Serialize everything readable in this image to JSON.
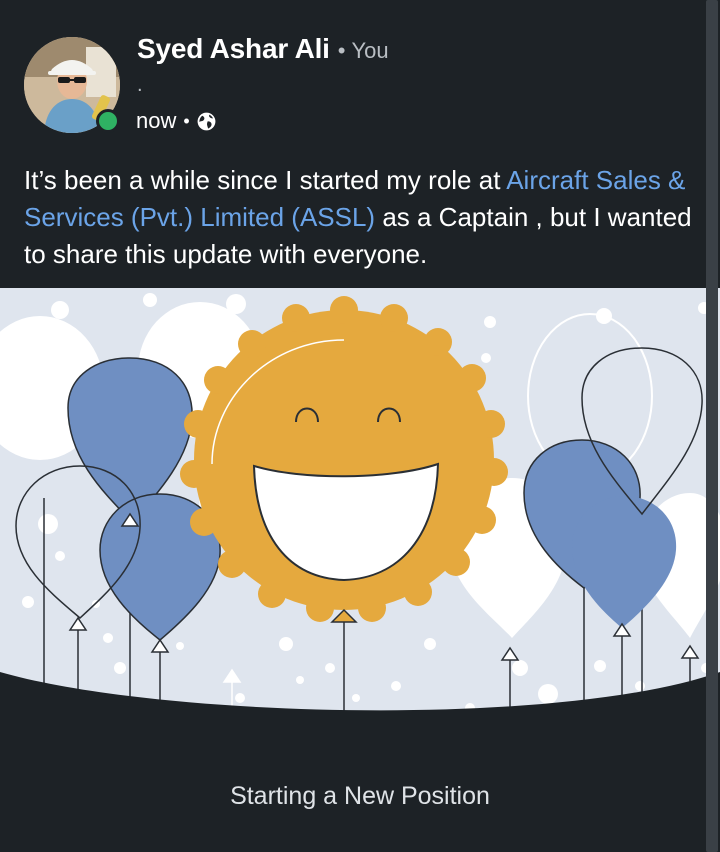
{
  "author": {
    "name": "Syed Ashar Ali",
    "relation": "You",
    "headline": ".",
    "timestamp": "now",
    "visibility_icon": "globe-icon",
    "presence_color": "#2fb263"
  },
  "post": {
    "text_before": "It’s been a while since I started my role at ",
    "company_link": "Aircraft Sales & Services (Pvt.) Limited (ASSL)",
    "text_after": " as a Captain , but I wanted to share this update with everyone."
  },
  "banner": {
    "illustration": "celebration-balloons-smiley",
    "caption": "Starting a New Position",
    "colors": {
      "background": "#dfe5ee",
      "balloon_blue": "#6f8fc2",
      "smiley": "#e5a93e",
      "link": "#6ba4e8"
    }
  }
}
